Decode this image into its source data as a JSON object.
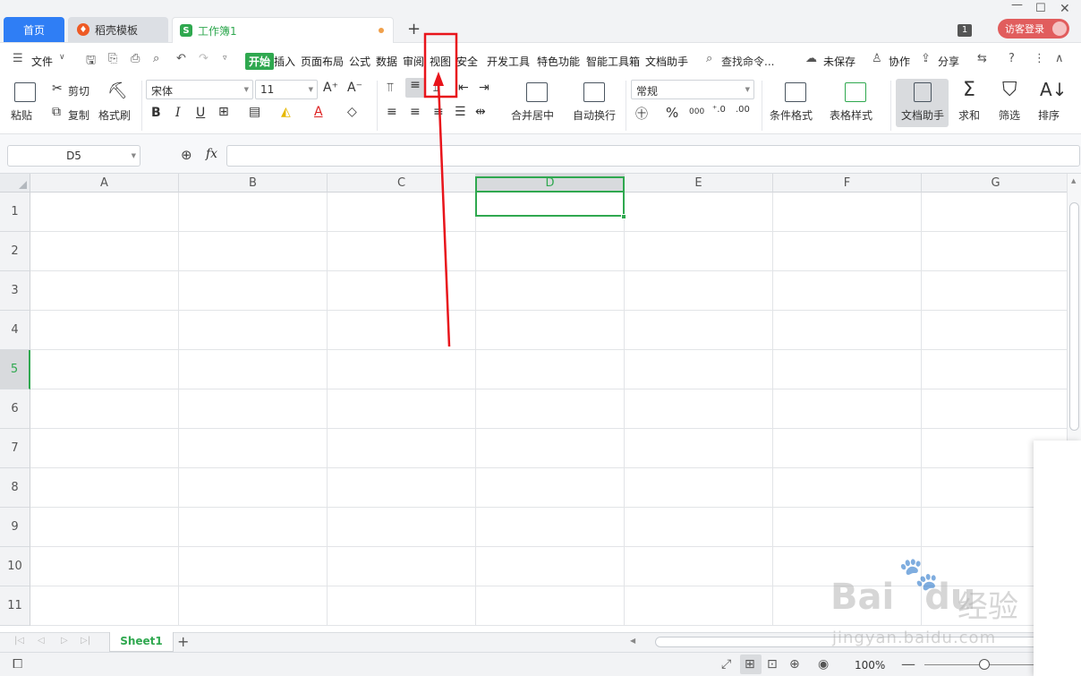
{
  "tabs": {
    "home": "首页",
    "daoke": "稻壳模板",
    "workbook": "工作簿1",
    "book_icon": "S",
    "new_tab": "+"
  },
  "window": {
    "count": "1",
    "login": "访客登录",
    "minimize": "—",
    "maximize": "☐",
    "close": "✕"
  },
  "menubar": {
    "file": "文件",
    "start": "开始",
    "insert": "插入",
    "page_layout": "页面布局",
    "formula": "公式",
    "data": "数据",
    "review": "审阅",
    "view": "视图",
    "security": "安全",
    "dev_tools": "开发工具",
    "features": "特色功能",
    "smart_toolbox": "智能工具箱",
    "doc_assistant": "文档助手",
    "search": "查找命令...",
    "unsaved": "未保存",
    "collaborate": "协作",
    "share": "分享"
  },
  "ribbon": {
    "paste": "粘贴",
    "cut": "剪切",
    "copy": "复制",
    "format_painter": "格式刷",
    "font_name": "宋体",
    "font_size": "11",
    "bold": "B",
    "italic": "I",
    "underline": "U",
    "merge_center": "合并居中",
    "auto_wrap": "自动换行",
    "number_format": "常规",
    "percent": "%",
    "thousands": "000",
    "cond_format": "条件格式",
    "table_style": "表格样式",
    "doc_assistant": "文档助手",
    "sum": "求和",
    "filter": "筛选",
    "sort": "排序"
  },
  "formula_bar": {
    "name_box": "D5",
    "fx": "fx",
    "value": ""
  },
  "grid": {
    "columns": [
      "A",
      "B",
      "C",
      "D",
      "E",
      "F",
      "G"
    ],
    "rows": [
      "1",
      "2",
      "3",
      "4",
      "5",
      "6",
      "7",
      "8",
      "9",
      "10",
      "11"
    ],
    "active_column": "D",
    "active_row": "5"
  },
  "sheets": {
    "active": "Sheet1",
    "add": "+"
  },
  "status": {
    "zoom": "100%",
    "zoom_minus": "—"
  },
  "watermark": {
    "logo": "Bai",
    "logo_tail": "du",
    "cn": "经验",
    "url": "jingyan.baidu.com"
  },
  "colors": {
    "accent_green": "#2fa84f",
    "home_tab_blue": "#2f7ef5",
    "annotation_red": "#e8141b",
    "login_red": "#e15d5d"
  }
}
